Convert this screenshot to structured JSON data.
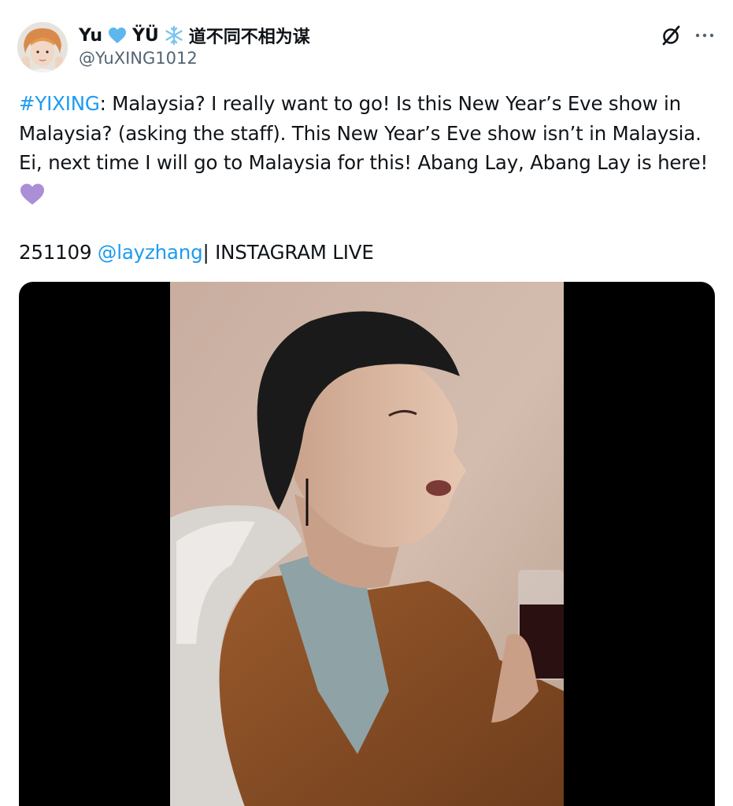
{
  "tweet": {
    "author": {
      "name_prefix": "Yu",
      "name_middle": "ŸÜ",
      "name_suffix": "道不同不相为谋",
      "handle": "@YuXING1012"
    },
    "text": {
      "hashtag": "#YIXING",
      "line1_rest": ": Malaysia? I really want to go! Is this New Year’s Eve show in",
      "line2": "Malaysia? (asking the staff). This New Year’s Eve show isn’t in Malaysia.",
      "line3": "Ei, next time I will go to Malaysia for this! Abang Lay, Abang Lay is here!"
    },
    "meta": {
      "date": "251109",
      "mention": "@layzhang",
      "source": "| INSTAGRAM LIVE"
    },
    "media": {
      "type": "video"
    }
  },
  "icons": {
    "heart": "blue-heart-emoji",
    "snow": "snowflake-emoji",
    "purple_heart": "purple-heart-emoji",
    "grok": "grok-icon",
    "more": "more-icon"
  },
  "colors": {
    "link": "#1d9bf0",
    "text": "#0f1419",
    "secondary": "#536471",
    "heart_blue": "#5db6ee",
    "heart_purple": "#aa8ed6"
  }
}
